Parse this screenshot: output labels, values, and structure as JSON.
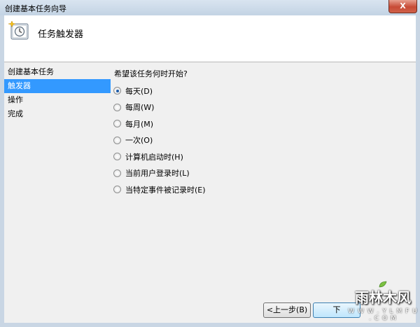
{
  "window": {
    "title": "创建基本任务向导",
    "close_label": "X"
  },
  "header": {
    "title": "任务触发器",
    "icon": "task-clock-icon"
  },
  "nav": {
    "items": [
      {
        "label": "创建基本任务",
        "selected": false
      },
      {
        "label": "触发器",
        "selected": true
      },
      {
        "label": "操作",
        "selected": false
      },
      {
        "label": "完成",
        "selected": false
      }
    ]
  },
  "main": {
    "question": "希望该任务何时开始?",
    "options": [
      {
        "label": "每天(D)",
        "checked": true
      },
      {
        "label": "每周(W)",
        "checked": false
      },
      {
        "label": "每月(M)",
        "checked": false
      },
      {
        "label": "一次(O)",
        "checked": false
      },
      {
        "label": "计算机启动时(H)",
        "checked": false
      },
      {
        "label": "当前用户登录时(L)",
        "checked": false
      },
      {
        "label": "当特定事件被记录时(E)",
        "checked": false
      }
    ]
  },
  "footer": {
    "back_label": "<上一步(B)",
    "next_label": "下"
  },
  "watermark": {
    "text": "雨林木风",
    "url": "W W W . Y L M F U . C O M"
  },
  "colors": {
    "selection": "#3399ff",
    "frame": "#c9d6e4"
  }
}
